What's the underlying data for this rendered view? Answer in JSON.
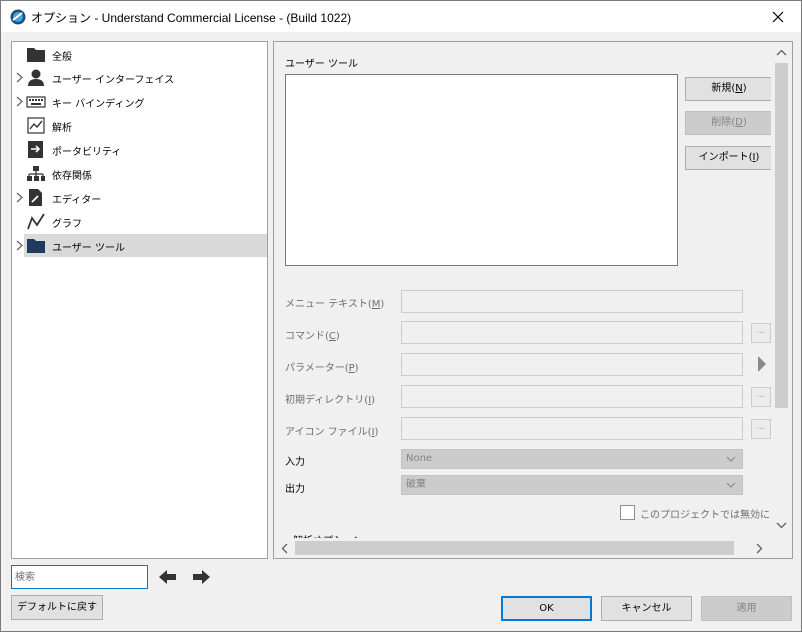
{
  "window": {
    "title": "オプション - Understand Commercial License - (Build 1022)"
  },
  "tree": {
    "items": [
      {
        "label": "全般",
        "icon": "folder-icon",
        "expandable": false
      },
      {
        "label": "ユーザー インターフェイス",
        "icon": "user-icon",
        "expandable": true
      },
      {
        "label": "キー バインディング",
        "icon": "keyboard-icon",
        "expandable": true
      },
      {
        "label": "解析",
        "icon": "analysis-chart-icon",
        "expandable": false
      },
      {
        "label": "ポータビリティ",
        "icon": "portability-icon",
        "expandable": false
      },
      {
        "label": "依存関係",
        "icon": "dependency-tree-icon",
        "expandable": false
      },
      {
        "label": "エディター",
        "icon": "editor-document-icon",
        "expandable": true
      },
      {
        "label": "グラフ",
        "icon": "graph-line-icon",
        "expandable": false
      },
      {
        "label": "ユーザー ツール",
        "icon": "folder-icon",
        "expandable": true,
        "selected": true
      }
    ]
  },
  "panel": {
    "section_title": "ユーザー ツール",
    "buttons": {
      "new_label": "新規(",
      "new_key": "N",
      "delete_label": "削除(",
      "delete_key": "D",
      "import_label": "インポート(",
      "import_key": "I"
    },
    "fields": {
      "menu_text_label": "メニュー テキスト(",
      "menu_text_key": "M",
      "command_label": "コマンド(",
      "command_key": "C",
      "parameter_label": "パラメーター(",
      "parameter_key": "P",
      "initial_dir_label": "初期ディレクトリ(",
      "initial_dir_key": "I",
      "icon_file_label": "アイコン ファイル(",
      "icon_file_key": "I",
      "input_label": "入力",
      "input_value": "None",
      "output_label": "出力",
      "output_value": "破棄",
      "dots": "..."
    },
    "disable_checkbox_label": "このプロジェクトでは無効にする",
    "analysis_options_label": "解析オプション:"
  },
  "bottom": {
    "search_placeholder": "検索",
    "restore_defaults": "デフォルトに戻す",
    "ok": "OK",
    "cancel": "キャンセル",
    "apply": "適用"
  },
  "colors": {
    "accent": "#0078d7",
    "selected_row": "#d9d9d9",
    "disabled_text": "#838383",
    "folder": "#333333",
    "selected_folder": "#1f3a5f"
  }
}
